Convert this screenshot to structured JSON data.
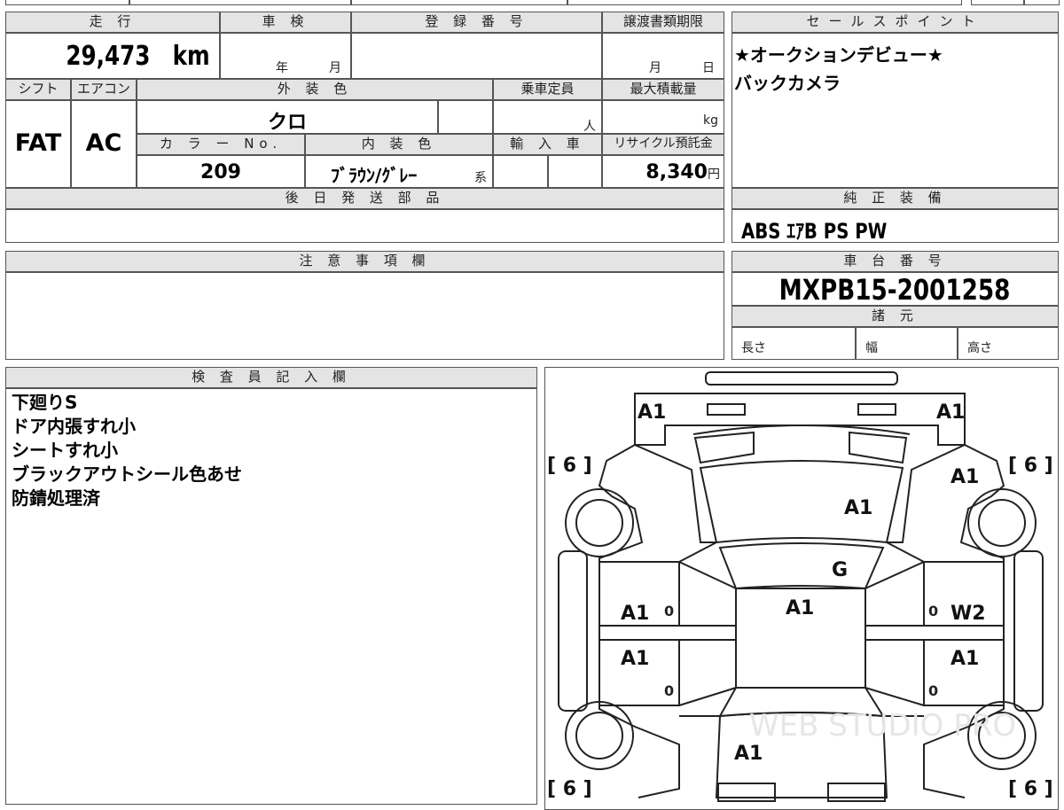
{
  "vehicle": {
    "mileage_label": "走 行",
    "mileage_value": "29,473",
    "mileage_unit": "km",
    "inspection_label": "車 検",
    "inspection_year": "年",
    "inspection_month": "月",
    "registration_label": "登 録 番 号",
    "transfer_label": "譲渡書類期限",
    "transfer_month": "月",
    "transfer_day": "日",
    "shift_label": "シフト",
    "shift_value": "FAT",
    "ac_label": "エアコン",
    "ac_value": "AC",
    "exterior_label": "外 装 色",
    "exterior_value": "クロ",
    "capacity_label": "乗車定員",
    "capacity_unit": "人",
    "maxload_label": "最大積載量",
    "maxload_unit": "kg",
    "colorno_label": "カ ラ ー No.",
    "colorno_value": "209",
    "interior_label": "内 装 色",
    "interior_value": "ﾌﾞﾗｳﾝ/ｸﾞﾚｰ",
    "interior_suffix": "系",
    "import_label": "輸 入 車",
    "recycle_label": "リサイクル預託金",
    "recycle_value": "8,340",
    "recycle_unit": "円",
    "later_parts_label": "後 日 発 送 部 品",
    "notes_label": "注 意 事 項 欄"
  },
  "sales": {
    "label": "セールスポイント",
    "lines": [
      "★オークションデビュー★",
      "バックカメラ"
    ],
    "equipment_label": "純 正 装 備",
    "equipment_value": "ABS ｴｱB PS PW",
    "chassis_label": "車 台 番 号",
    "chassis_value": "MXPB15-2001258",
    "specs_label": "諸 元",
    "length_label": "長さ",
    "width_label": "幅",
    "height_label": "高さ"
  },
  "inspector": {
    "label": "検 査 員 記 入 欄",
    "lines": [
      "下廻りS",
      "ドア内張すれ小",
      "シートすれ小",
      "ブラックアウトシール色あせ",
      "防錆処理済"
    ]
  },
  "diagram": {
    "marks": {
      "front_left_corner": "A1",
      "front_right_corner": "A1",
      "right_fender": "A1",
      "hood": "A1",
      "windshield": "G",
      "roof": "A1",
      "left_front_door": "A1",
      "right_front_door": "W2",
      "left_rear_door": "A1",
      "right_rear_door": "A1",
      "rear_glass": "A1",
      "front_left_tire": "[ 6 ]",
      "front_right_tire": "[ 6 ]",
      "rear_left_tire": "[ 6 ]",
      "rear_right_tire": "[ 6 ]",
      "zero": "0"
    },
    "watermark": "WEB STUDIO PRO"
  }
}
